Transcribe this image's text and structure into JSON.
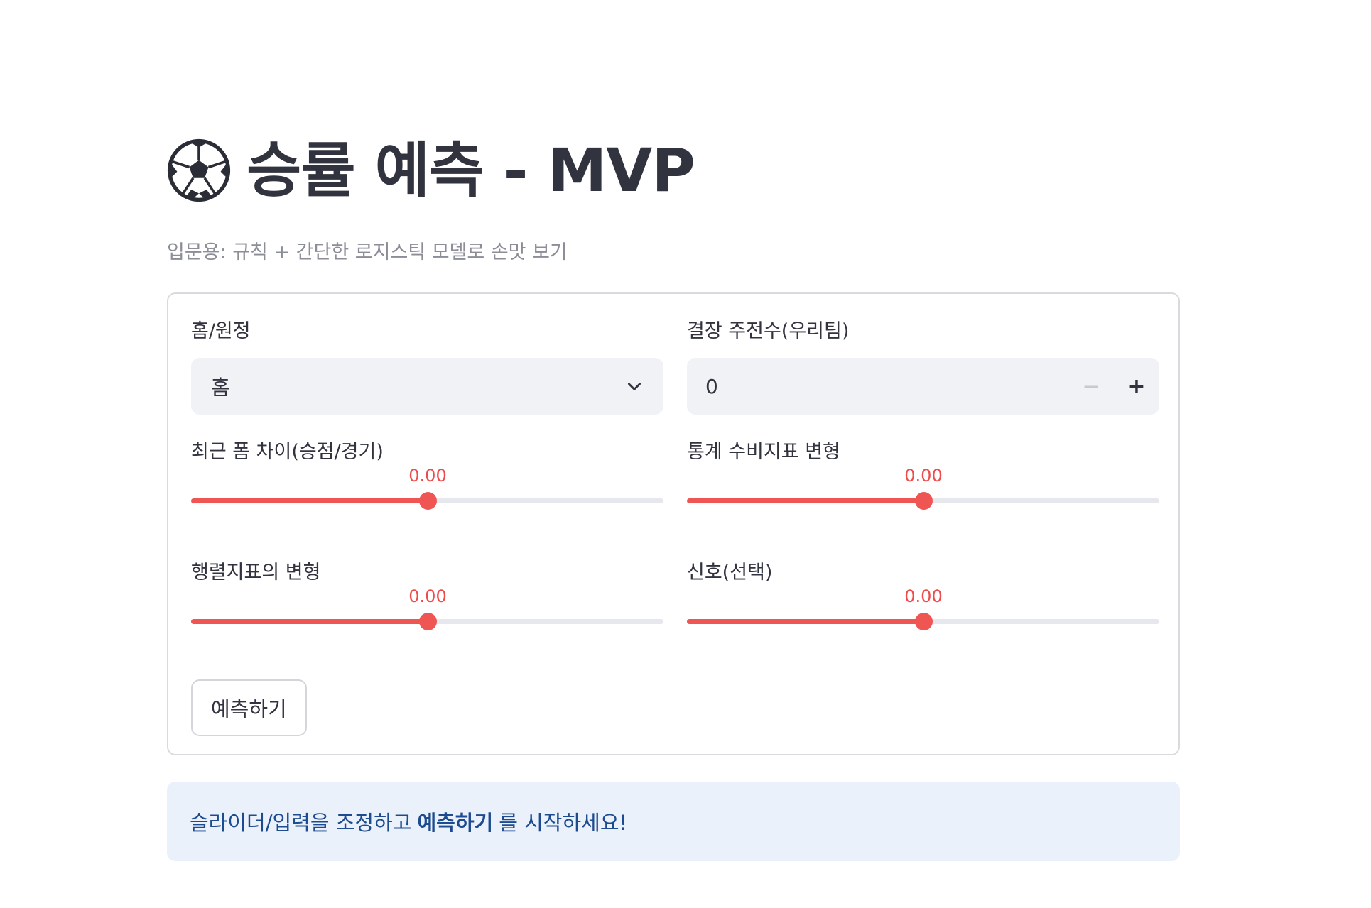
{
  "header": {
    "icon": "soccer-ball-icon",
    "title": "승률 예측 - MVP",
    "caption": "입문용: 규칙 + 간단한 로지스틱 모델로 손맛 보기"
  },
  "form": {
    "home_away": {
      "label": "홈/원정",
      "value": "홈",
      "icon": "chevron-down-icon"
    },
    "absent_players": {
      "label": "결장 주전수(우리팀)",
      "value": "0",
      "minus": "−",
      "plus": "+"
    },
    "recent_form": {
      "label": "최근 폼 차이(승점/경기)",
      "value_text": "0.00",
      "level": 0.5
    },
    "defense_stat": {
      "label": "통계 수비지표 변형",
      "value_text": "0.00",
      "level": 0.5
    },
    "matrix_stat": {
      "label": "행렬지표의 변형",
      "value_text": "0.00",
      "level": 0.5
    },
    "preference": {
      "label": "신호(선택)",
      "value_text": "0.00",
      "level": 0.5
    },
    "submit_label": "예측하기"
  },
  "alert": {
    "before": "슬라이더/입력을 조정하고",
    "bold": "예측하기",
    "after": "를 시작하세요!"
  },
  "colors": {
    "accent": "#ef5552",
    "text": "#31333f",
    "input_bg": "#f0f2f6",
    "info_bg": "#eaf1fb",
    "info_text": "#1d4b8f"
  }
}
